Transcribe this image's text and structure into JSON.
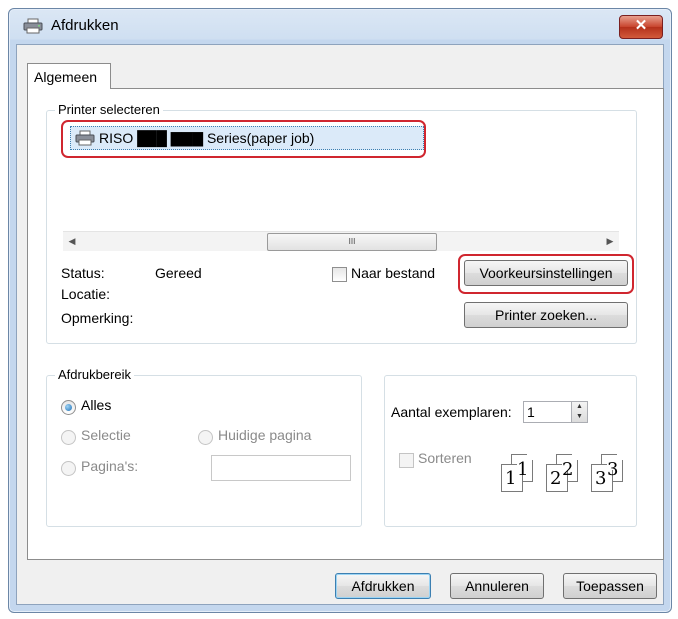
{
  "window": {
    "title": "Afdrukken",
    "close_glyph": "✕"
  },
  "tabs": [
    {
      "label": "Algemeen"
    }
  ],
  "printer_group": {
    "label": "Printer selecteren",
    "printers": [
      {
        "name": "RISO ███ ▇▇▇ Series(paper job)"
      }
    ],
    "scroll_thumb": "III",
    "status_label": "Status:",
    "status_value": "Gereed",
    "location_label": "Locatie:",
    "comment_label": "Opmerking:",
    "print_to_file_label": "Naar bestand",
    "preferences_button": "Voorkeursinstellingen",
    "find_printer_button": "Printer zoeken..."
  },
  "range_group": {
    "label": "Afdrukbereik",
    "all_label": "Alles",
    "selection_label": "Selectie",
    "current_page_label": "Huidige pagina",
    "pages_label": "Pagina's:",
    "pages_value": ""
  },
  "copies_group": {
    "copies_label": "Aantal exemplaren:",
    "copies_value": "1",
    "collate_label": "Sorteren",
    "collate_icon": "collate-icon",
    "page_numbers": [
      "1",
      "1",
      "2",
      "2",
      "3",
      "3"
    ]
  },
  "footer": {
    "print_button": "Afdrukken",
    "cancel_button": "Annuleren",
    "apply_button": "Toepassen"
  },
  "colors": {
    "highlight": "#d0262f",
    "selection": "#dbeaf9",
    "title_bar": "#c4d7ee"
  }
}
